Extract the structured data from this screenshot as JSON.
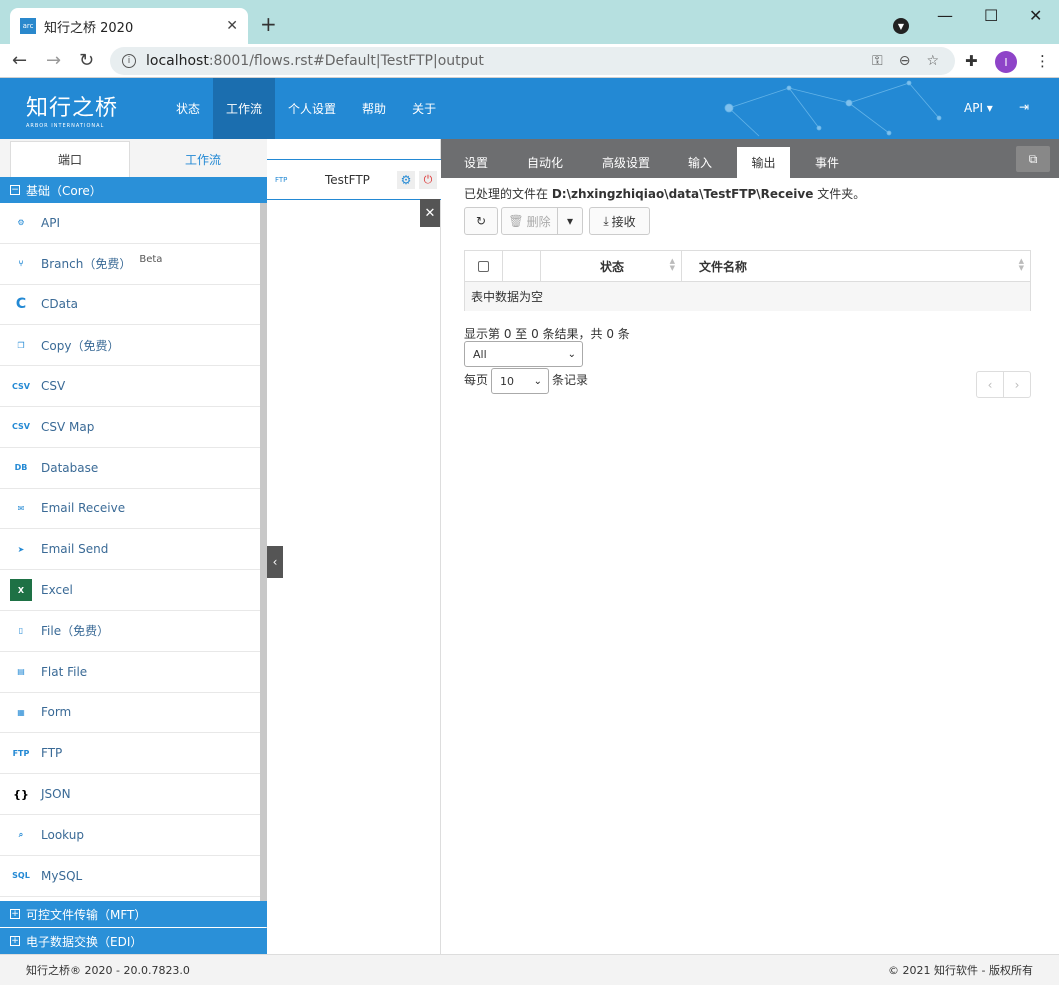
{
  "browser": {
    "tab_title": "知行之桥 2020",
    "favicon_text": "arc",
    "url_host": "localhost",
    "url_rest": ":8001/flows.rst#Default|TestFTP|output",
    "avatar_letter": "I"
  },
  "header": {
    "logo_text": "知行之桥",
    "logo_sub": "ARBOR INTERNATIONAL",
    "nav": [
      "状态",
      "工作流",
      "个人设置",
      "帮助",
      "关于"
    ],
    "active_nav": "工作流",
    "api_label": "API ▾"
  },
  "sidebar": {
    "tabs": [
      "端口",
      "工作流"
    ],
    "active_tab": "端口",
    "groups": {
      "core": "基础（Core）",
      "mft": "可控文件传输（MFT）",
      "edi": "电子数据交换（EDI）"
    },
    "items": [
      {
        "label": "API",
        "icon": "api-icon",
        "glyph": "⚙"
      },
      {
        "label": "Branch（免费）",
        "icon": "branch-icon",
        "glyph": "⑂",
        "badge": "Beta"
      },
      {
        "label": "CData",
        "icon": "cdata-icon",
        "glyph": "C"
      },
      {
        "label": "Copy（免费）",
        "icon": "copy-icon",
        "glyph": "❐"
      },
      {
        "label": "CSV",
        "icon": "csv-icon",
        "glyph": "CSV"
      },
      {
        "label": "CSV Map",
        "icon": "csv-map-icon",
        "glyph": "CSV"
      },
      {
        "label": "Database",
        "icon": "database-icon",
        "glyph": "DB"
      },
      {
        "label": "Email Receive",
        "icon": "email-receive-icon",
        "glyph": "✉"
      },
      {
        "label": "Email Send",
        "icon": "email-send-icon",
        "glyph": "➤"
      },
      {
        "label": "Excel",
        "icon": "excel-icon",
        "glyph": "X"
      },
      {
        "label": "File（免费）",
        "icon": "file-icon",
        "glyph": "▯"
      },
      {
        "label": "Flat File",
        "icon": "flat-file-icon",
        "glyph": "▤"
      },
      {
        "label": "Form",
        "icon": "form-icon",
        "glyph": "▦"
      },
      {
        "label": "FTP",
        "icon": "ftp-icon",
        "glyph": "FTP"
      },
      {
        "label": "JSON",
        "icon": "json-icon",
        "glyph": "{}"
      },
      {
        "label": "Lookup",
        "icon": "lookup-icon",
        "glyph": "⌕"
      },
      {
        "label": "MySQL",
        "icon": "mysql-icon",
        "glyph": "SQL"
      }
    ]
  },
  "flow": {
    "node_label": "TestFTP",
    "node_icon_text": "FTP"
  },
  "content": {
    "tabs": [
      "设置",
      "自动化",
      "高级设置",
      "输入",
      "输出",
      "事件"
    ],
    "active_tab": "输出",
    "processed_prefix": "已处理的文件在",
    "processed_path": "D:\\zhxingzhiqiao\\data\\TestFTP\\Receive",
    "processed_suffix": "文件夹。",
    "delete_label": "删除",
    "receive_label": "接收",
    "columns": [
      "状态",
      "文件名称"
    ],
    "empty_text": "表中数据为空",
    "info_text": "显示第 0 至 0 条结果，共 0 条",
    "filter_value": "All",
    "per_page_prefix": "每页",
    "per_page_value": "10",
    "per_page_suffix": "条记录"
  },
  "footer": {
    "left": "知行之桥® 2020 - 20.0.7823.0",
    "right": "© 2021 知行软件 - 版权所有"
  }
}
